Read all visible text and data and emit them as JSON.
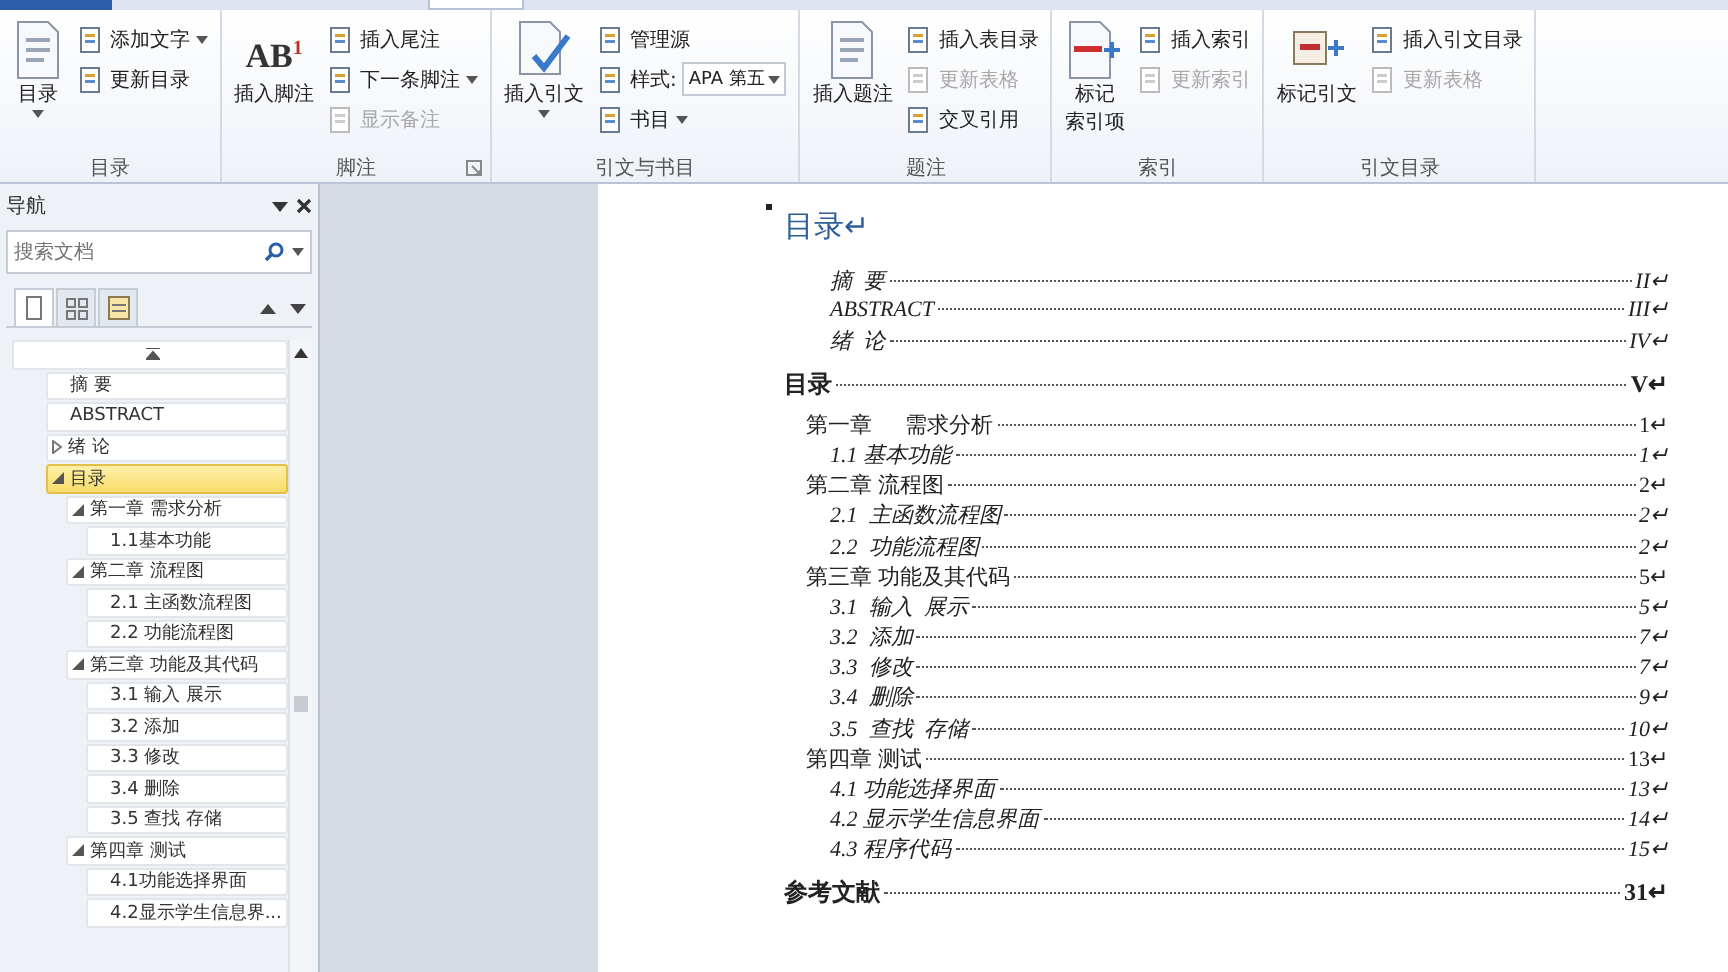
{
  "ribbon_groups": [
    {
      "label": "目录",
      "large": [
        {
          "label_lines": [
            "目录"
          ],
          "menu": true
        }
      ],
      "small": [
        {
          "label": "添加文字",
          "menu": true,
          "disabled": false
        },
        {
          "label": "更新目录",
          "disabled": false
        }
      ]
    },
    {
      "label": "脚注",
      "launcher": true,
      "large": [
        {
          "label_lines": [
            "插入脚注"
          ],
          "glyph": "AB$^{1}$"
        }
      ],
      "small": [
        {
          "label": "插入尾注",
          "disabled": false
        },
        {
          "label": "下一条脚注",
          "menu": true,
          "disabled": false
        },
        {
          "label": "显示备注",
          "disabled": true
        }
      ]
    },
    {
      "label": "引文与书目",
      "large": [
        {
          "label_lines": [
            "插入引文"
          ],
          "menu": true
        }
      ],
      "small": [
        {
          "label": "管理源",
          "disabled": false
        },
        {
          "label": "样式:",
          "disabled": false,
          "select": "APA 第五"
        },
        {
          "label": "书目",
          "menu": true,
          "disabled": false
        }
      ]
    },
    {
      "label": "题注",
      "large": [
        {
          "label_lines": [
            "插入题注"
          ]
        }
      ],
      "small": [
        {
          "label": "插入表目录",
          "disabled": false
        },
        {
          "label": "更新表格",
          "disabled": true
        },
        {
          "label": "交叉引用",
          "disabled": false
        }
      ]
    },
    {
      "label": "索引",
      "large": [
        {
          "label_lines": [
            "标记",
            "索引项"
          ]
        }
      ],
      "small": [
        {
          "label": "插入索引",
          "disabled": false
        },
        {
          "label": "更新索引",
          "disabled": true
        }
      ]
    },
    {
      "label": "引文目录",
      "large": [
        {
          "label_lines": [
            "标记引文"
          ]
        }
      ],
      "small": [
        {
          "label": "插入引文目录",
          "disabled": false
        },
        {
          "label": "更新表格",
          "disabled": true
        }
      ]
    }
  ],
  "nav": {
    "title": "导航",
    "search": {
      "placeholder": "搜索文档"
    },
    "views": [
      {
        "kind": "headings",
        "selected": true
      },
      {
        "kind": "pages",
        "selected": false
      },
      {
        "kind": "results",
        "selected": false
      }
    ],
    "tree": [
      {
        "label": "摘 要",
        "selected": false
      },
      {
        "label": "ABSTRACT",
        "selected": false
      },
      {
        "label": "绪 论",
        "selected": false,
        "expanded": false
      },
      {
        "label": "目录",
        "selected": true,
        "expanded": true,
        "children": [
          {
            "label": "第一章 需求分析",
            "selected": false,
            "expanded": true,
            "children": [
              {
                "label": "1.1基本功能",
                "selected": false
              }
            ]
          },
          {
            "label": "第二章 流程图",
            "selected": false,
            "expanded": true,
            "children": [
              {
                "label": "2.1 主函数流程图",
                "selected": false
              },
              {
                "label": "2.2 功能流程图",
                "selected": false
              }
            ]
          },
          {
            "label": "第三章 功能及其代码",
            "selected": false,
            "expanded": true,
            "children": [
              {
                "label": "3.1 输入 展示",
                "selected": false
              },
              {
                "label": "3.2 添加",
                "selected": false
              },
              {
                "label": "3.3 修改",
                "selected": false
              },
              {
                "label": "3.4 删除",
                "selected": false
              },
              {
                "label": "3.5 查找 存储",
                "selected": false
              }
            ]
          },
          {
            "label": "第四章 测试",
            "selected": false,
            "expanded": true,
            "children": [
              {
                "label": "4.1功能选择界面",
                "selected": false
              },
              {
                "label": "4.2显示学生信息界...",
                "selected": false
              }
            ]
          }
        ]
      }
    ]
  },
  "document": {
    "heading": "目录↵",
    "entries": [
      {
        "kind": "front",
        "text": "摘  要",
        "page": "II↵"
      },
      {
        "kind": "front",
        "text": "ABSTRACT",
        "page": "III↵"
      },
      {
        "kind": "front",
        "text": "绪  论",
        "page": "IV↵"
      },
      {
        "kind": "main",
        "text": "目录",
        "page": "V↵"
      },
      {
        "kind": "chapter",
        "text": "第一章      需求分析",
        "page": "1↵"
      },
      {
        "kind": "section",
        "text": "1.1 基本功能",
        "page": "1↵"
      },
      {
        "kind": "chapter",
        "text": "第二章 流程图",
        "page": "2↵"
      },
      {
        "kind": "section",
        "text": "2.1  主函数流程图",
        "page": "2↵"
      },
      {
        "kind": "section",
        "text": "2.2  功能流程图",
        "page": "2↵"
      },
      {
        "kind": "chapter",
        "text": "第三章 功能及其代码",
        "page": "5↵"
      },
      {
        "kind": "section",
        "text": "3.1  输入  展示",
        "page": "5↵"
      },
      {
        "kind": "section",
        "text": "3.2  添加",
        "page": "7↵"
      },
      {
        "kind": "section",
        "text": "3.3  修改",
        "page": "7↵"
      },
      {
        "kind": "section",
        "text": "3.4  删除",
        "page": "9↵"
      },
      {
        "kind": "section",
        "text": "3.5  查找  存储",
        "page": "10↵"
      },
      {
        "kind": "chapter",
        "text": "第四章 测试",
        "page": "13↵"
      },
      {
        "kind": "section",
        "text": "4.1 功能选择界面",
        "page": "13↵"
      },
      {
        "kind": "section",
        "text": "4.2 显示学生信息界面",
        "page": "14↵"
      },
      {
        "kind": "section",
        "text": "4.3 程序代码",
        "page": "15↵"
      },
      {
        "kind": "main",
        "text": "参考文献",
        "page": "31↵"
      }
    ]
  }
}
